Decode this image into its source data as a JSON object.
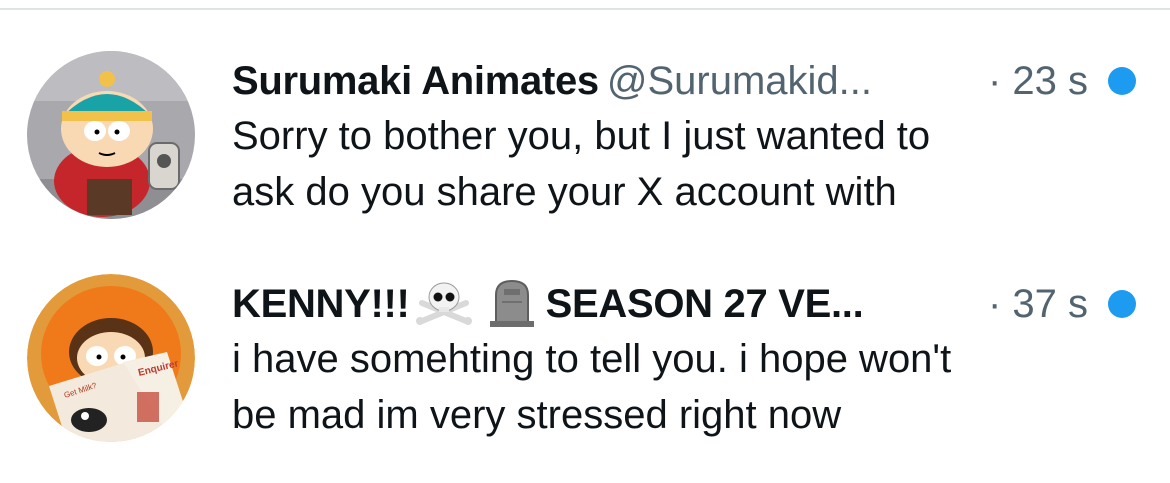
{
  "conversations": [
    {
      "name": "Surumaki Animates",
      "handle": "@Surumakid...",
      "time": "· 23 s",
      "unread": true,
      "avatar_icon": "cartman-avatar",
      "message_lines": [
        "Sorry to bother you, but I just wanted to",
        "ask do you share your X account with"
      ]
    },
    {
      "name_part1": "KENNY!!!",
      "emoji_1": "skull-and-crossbones",
      "emoji_2": "headstone",
      "name_part2": "SEASON 27 VE...",
      "time": "· 37 s",
      "unread": true,
      "avatar_icon": "kenny-avatar",
      "avatar_text": [
        "Get Milk?",
        "Enquirer"
      ],
      "message_lines": [
        "i have somehting to tell you. i hope won't",
        "be mad im very stressed right now"
      ]
    }
  ],
  "colors": {
    "unread_dot": "#1d9bf0",
    "primary_text": "#0f1419",
    "secondary_text": "#536471",
    "divider": "#dde3e7"
  }
}
